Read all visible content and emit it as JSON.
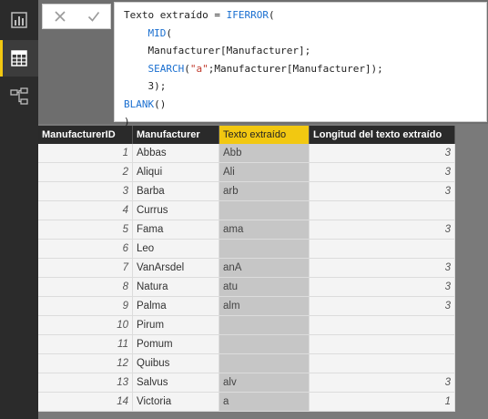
{
  "nav": {
    "items": [
      {
        "name": "report-view-icon",
        "active": false
      },
      {
        "name": "data-view-icon",
        "active": true
      },
      {
        "name": "relationships-view-icon",
        "active": false
      }
    ]
  },
  "formula_bar": {
    "cancel_symbol": "✕",
    "commit_symbol": "✓",
    "lines": [
      "Texto extraído = IFERROR(",
      "    MID(",
      "    Manufacturer[Manufacturer];",
      "    SEARCH(\"a\";Manufacturer[Manufacturer]);",
      "    3);",
      "BLANK()",
      ")"
    ]
  },
  "table": {
    "columns": [
      "ManufacturerID",
      "Manufacturer",
      "Texto extraído",
      "Longitud del texto extraído"
    ],
    "selected_column": 2,
    "rows": [
      [
        "1",
        "Abbas",
        "Abb",
        "3"
      ],
      [
        "2",
        "Aliqui",
        "Ali",
        "3"
      ],
      [
        "3",
        "Barba",
        "arb",
        "3"
      ],
      [
        "4",
        "Currus",
        "",
        ""
      ],
      [
        "5",
        "Fama",
        "ama",
        "3"
      ],
      [
        "6",
        "Leo",
        "",
        ""
      ],
      [
        "7",
        "VanArsdel",
        "anA",
        "3"
      ],
      [
        "8",
        "Natura",
        "atu",
        "3"
      ],
      [
        "9",
        "Palma",
        "alm",
        "3"
      ],
      [
        "10",
        "Pirum",
        "",
        ""
      ],
      [
        "11",
        "Pomum",
        "",
        ""
      ],
      [
        "12",
        "Quibus",
        "",
        ""
      ],
      [
        "13",
        "Salvus",
        "alv",
        "3"
      ],
      [
        "14",
        "Victoria",
        "a",
        "1"
      ]
    ]
  },
  "colors": {
    "accent": "#f2c811",
    "rail": "#2b2b2b",
    "header": "#2a2a2a",
    "selected_column_fill": "#c6c6c6"
  }
}
